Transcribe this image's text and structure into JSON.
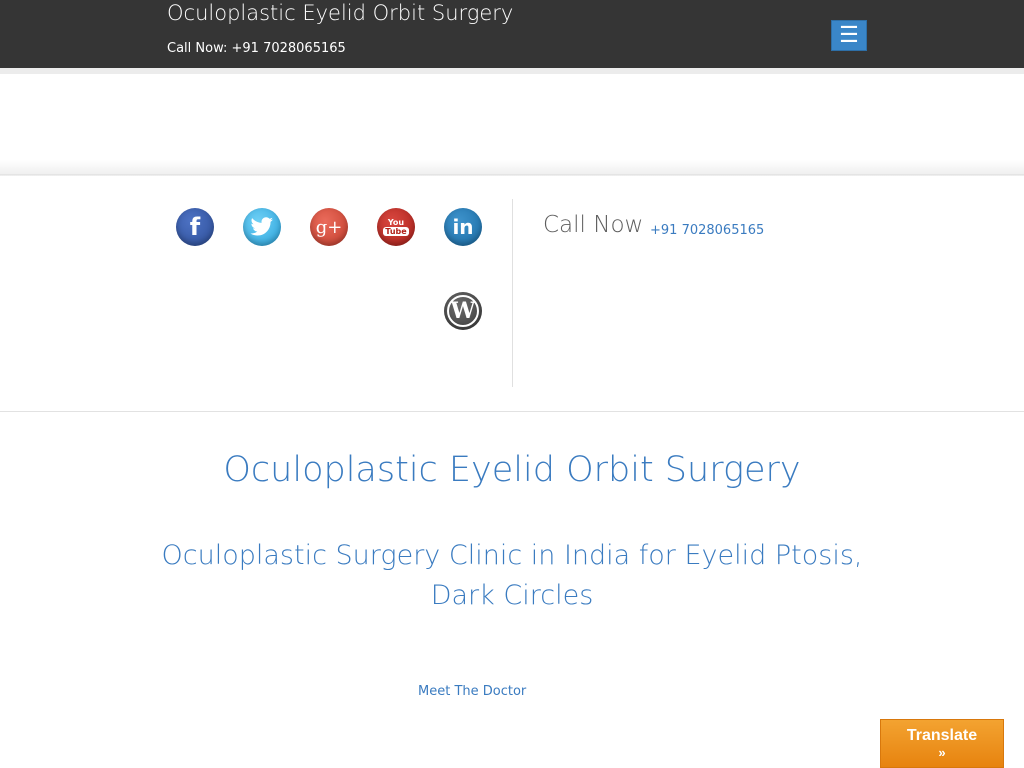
{
  "header": {
    "site_title": "Oculoplastic Eyelid Orbit Surgery",
    "call_now_text": "Call Now: +91 7028065165",
    "menu_icon": "☰"
  },
  "social": {
    "facebook_glyph": "f",
    "twitter_glyph": "🐦",
    "googleplus_glyph": "g+",
    "youtube_you": "You",
    "youtube_tube": "Tube",
    "linkedin_glyph": "in",
    "wordpress_glyph": "W"
  },
  "contact": {
    "label": "Call Now",
    "phone": "+91 7028065165"
  },
  "main": {
    "title": "Oculoplastic Eyelid Orbit Surgery",
    "subtitle": "Oculoplastic Surgery Clinic in India for Eyelid Ptosis, Dark Circles",
    "meet_link": "Meet The Doctor"
  },
  "translate": {
    "label": "Translate",
    "arrow": "»"
  },
  "colors": {
    "header_bg": "#353535",
    "accent_blue": "#3a7bc0",
    "translate_orange": "#f3a331"
  }
}
